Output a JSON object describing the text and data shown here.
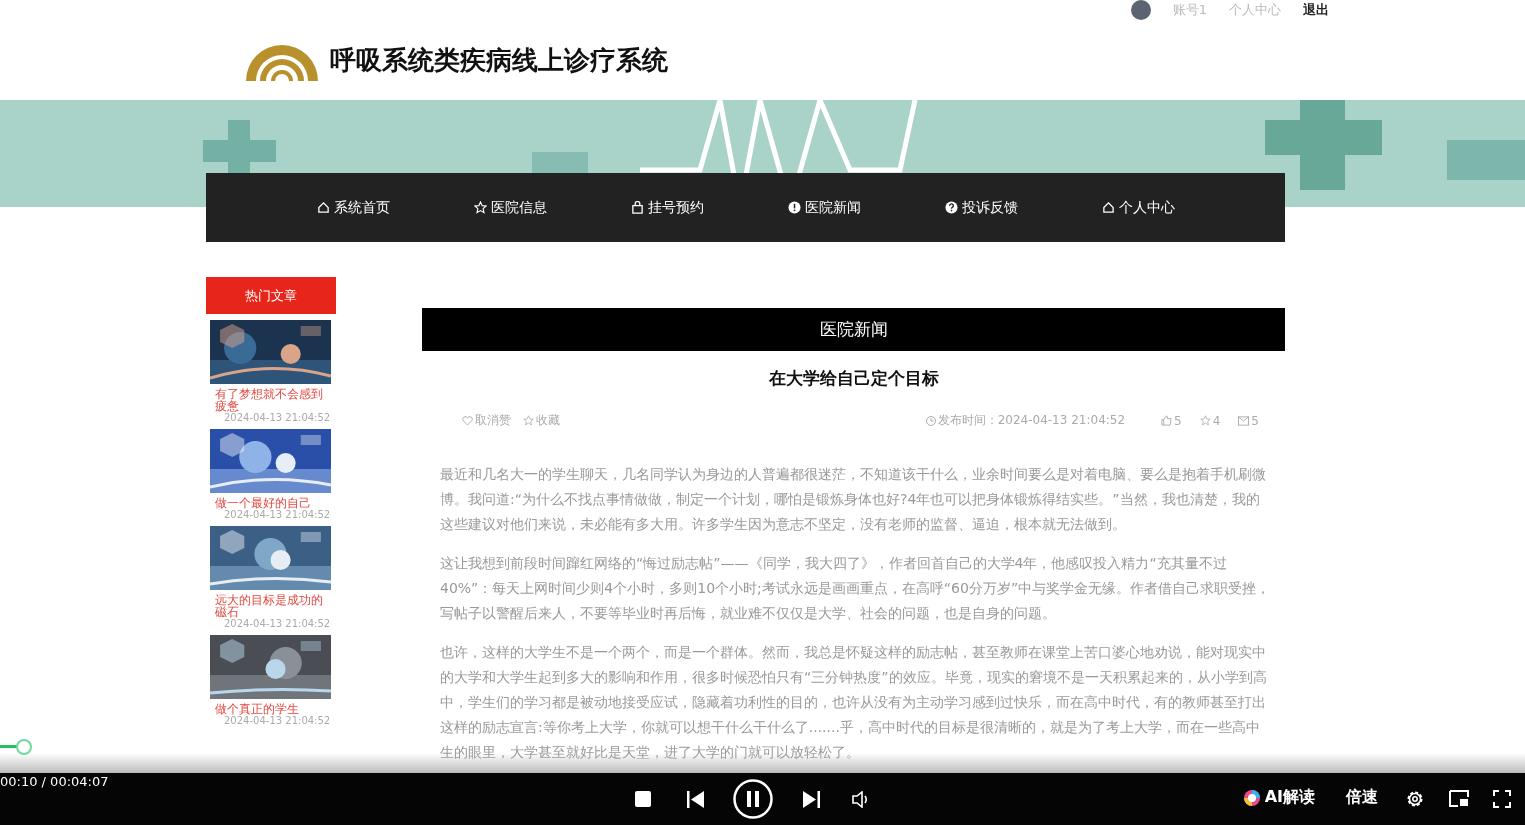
{
  "top_bar": {
    "account": "账号1",
    "links": [
      "个人中心",
      "退出"
    ]
  },
  "site": {
    "title": "呼吸系统类疾病线上诊疗系统"
  },
  "nav": [
    {
      "label": "系统首页"
    },
    {
      "label": "医院信息"
    },
    {
      "label": "挂号预约"
    },
    {
      "label": "医院新闻"
    },
    {
      "label": "投诉反馈"
    },
    {
      "label": "个人中心"
    }
  ],
  "sidebar": {
    "title": "热门文章",
    "articles": [
      {
        "title": "有了梦想就不会感到疲惫",
        "date": "2024-04-13 21:04:52",
        "kind": "picture"
      },
      {
        "title": "做一个最好的自己",
        "date": "2024-04-13 21:04:52",
        "kind": "picture"
      },
      {
        "title": "远大的目标是成功的磁石",
        "date": "2024-04-13 21:04:52",
        "kind": "picture"
      },
      {
        "title": "做个真正的学生",
        "date": "2024-04-13 21:04:52",
        "kind": "picture"
      }
    ]
  },
  "article": {
    "section": "医院新闻",
    "title": "在大学给自己定个目标",
    "actions": [
      {
        "label": "取消赞"
      },
      {
        "label": "收藏"
      }
    ],
    "published": "发布时间：2024-04-13 21:04:52",
    "stats": [
      {
        "value": "5"
      },
      {
        "value": "4"
      },
      {
        "value": "5"
      }
    ],
    "paragraphs": [
      "最近和几名大一的学生聊天，几名同学认为身边的人普遍都很迷茫，不知道该干什么，业余时间要么是对着电脑、要么是抱着手机刷微博。我问道:“为什么不找点事情做做，制定一个计划，哪怕是锻炼身体也好?4年也可以把身体锻炼得结实些。”当然，我也清楚，我的这些建议对他们来说，未必能有多大用。许多学生因为意志不坚定，没有老师的监督、逼迫，根本就无法做到。",
      "这让我想到前段时间蹿红网络的“悔过励志帖”——《同学，我大四了》，作者回首自己的大学4年，他感叹投入精力“充其量不过40%”：每天上网时间少则4个小时，多则10个小时;考试永远是画画重点，在高呼“60分万岁”中与奖学金无缘。作者借自己求职受挫，写帖子以警醒后来人，不要等毕业时再后悔，就业难不仅仅是大学、社会的问题，也是自身的问题。",
      "也许，这样的大学生不是一个两个，而是一个群体。然而，我总是怀疑这样的励志帖，甚至教师在课堂上苦口婆心地劝说，能对现实中的大学和大学生起到多大的影响和作用，很多时候恐怕只有“三分钟热度”的效应。毕竟，现实的窘境不是一天积累起来的，从小学到高中，学生们的学习都是被动地接受应试，隐藏着功利性的目的，也许从没有为主动学习感到过快乐，而在高中时代，有的教师甚至打出这样的励志宣言:等你考上大学，你就可以想干什么干什么了.......乎，高中时代的目标是很清晰的，就是为了考上大学，而在一些高中生的眼里，大学甚至就好比是天堂，进了大学的门就可以放轻松了。"
    ]
  },
  "player": {
    "time": "00:10 / 00:04:07",
    "ai_label": "AI解读",
    "speed_label": "倍速"
  }
}
